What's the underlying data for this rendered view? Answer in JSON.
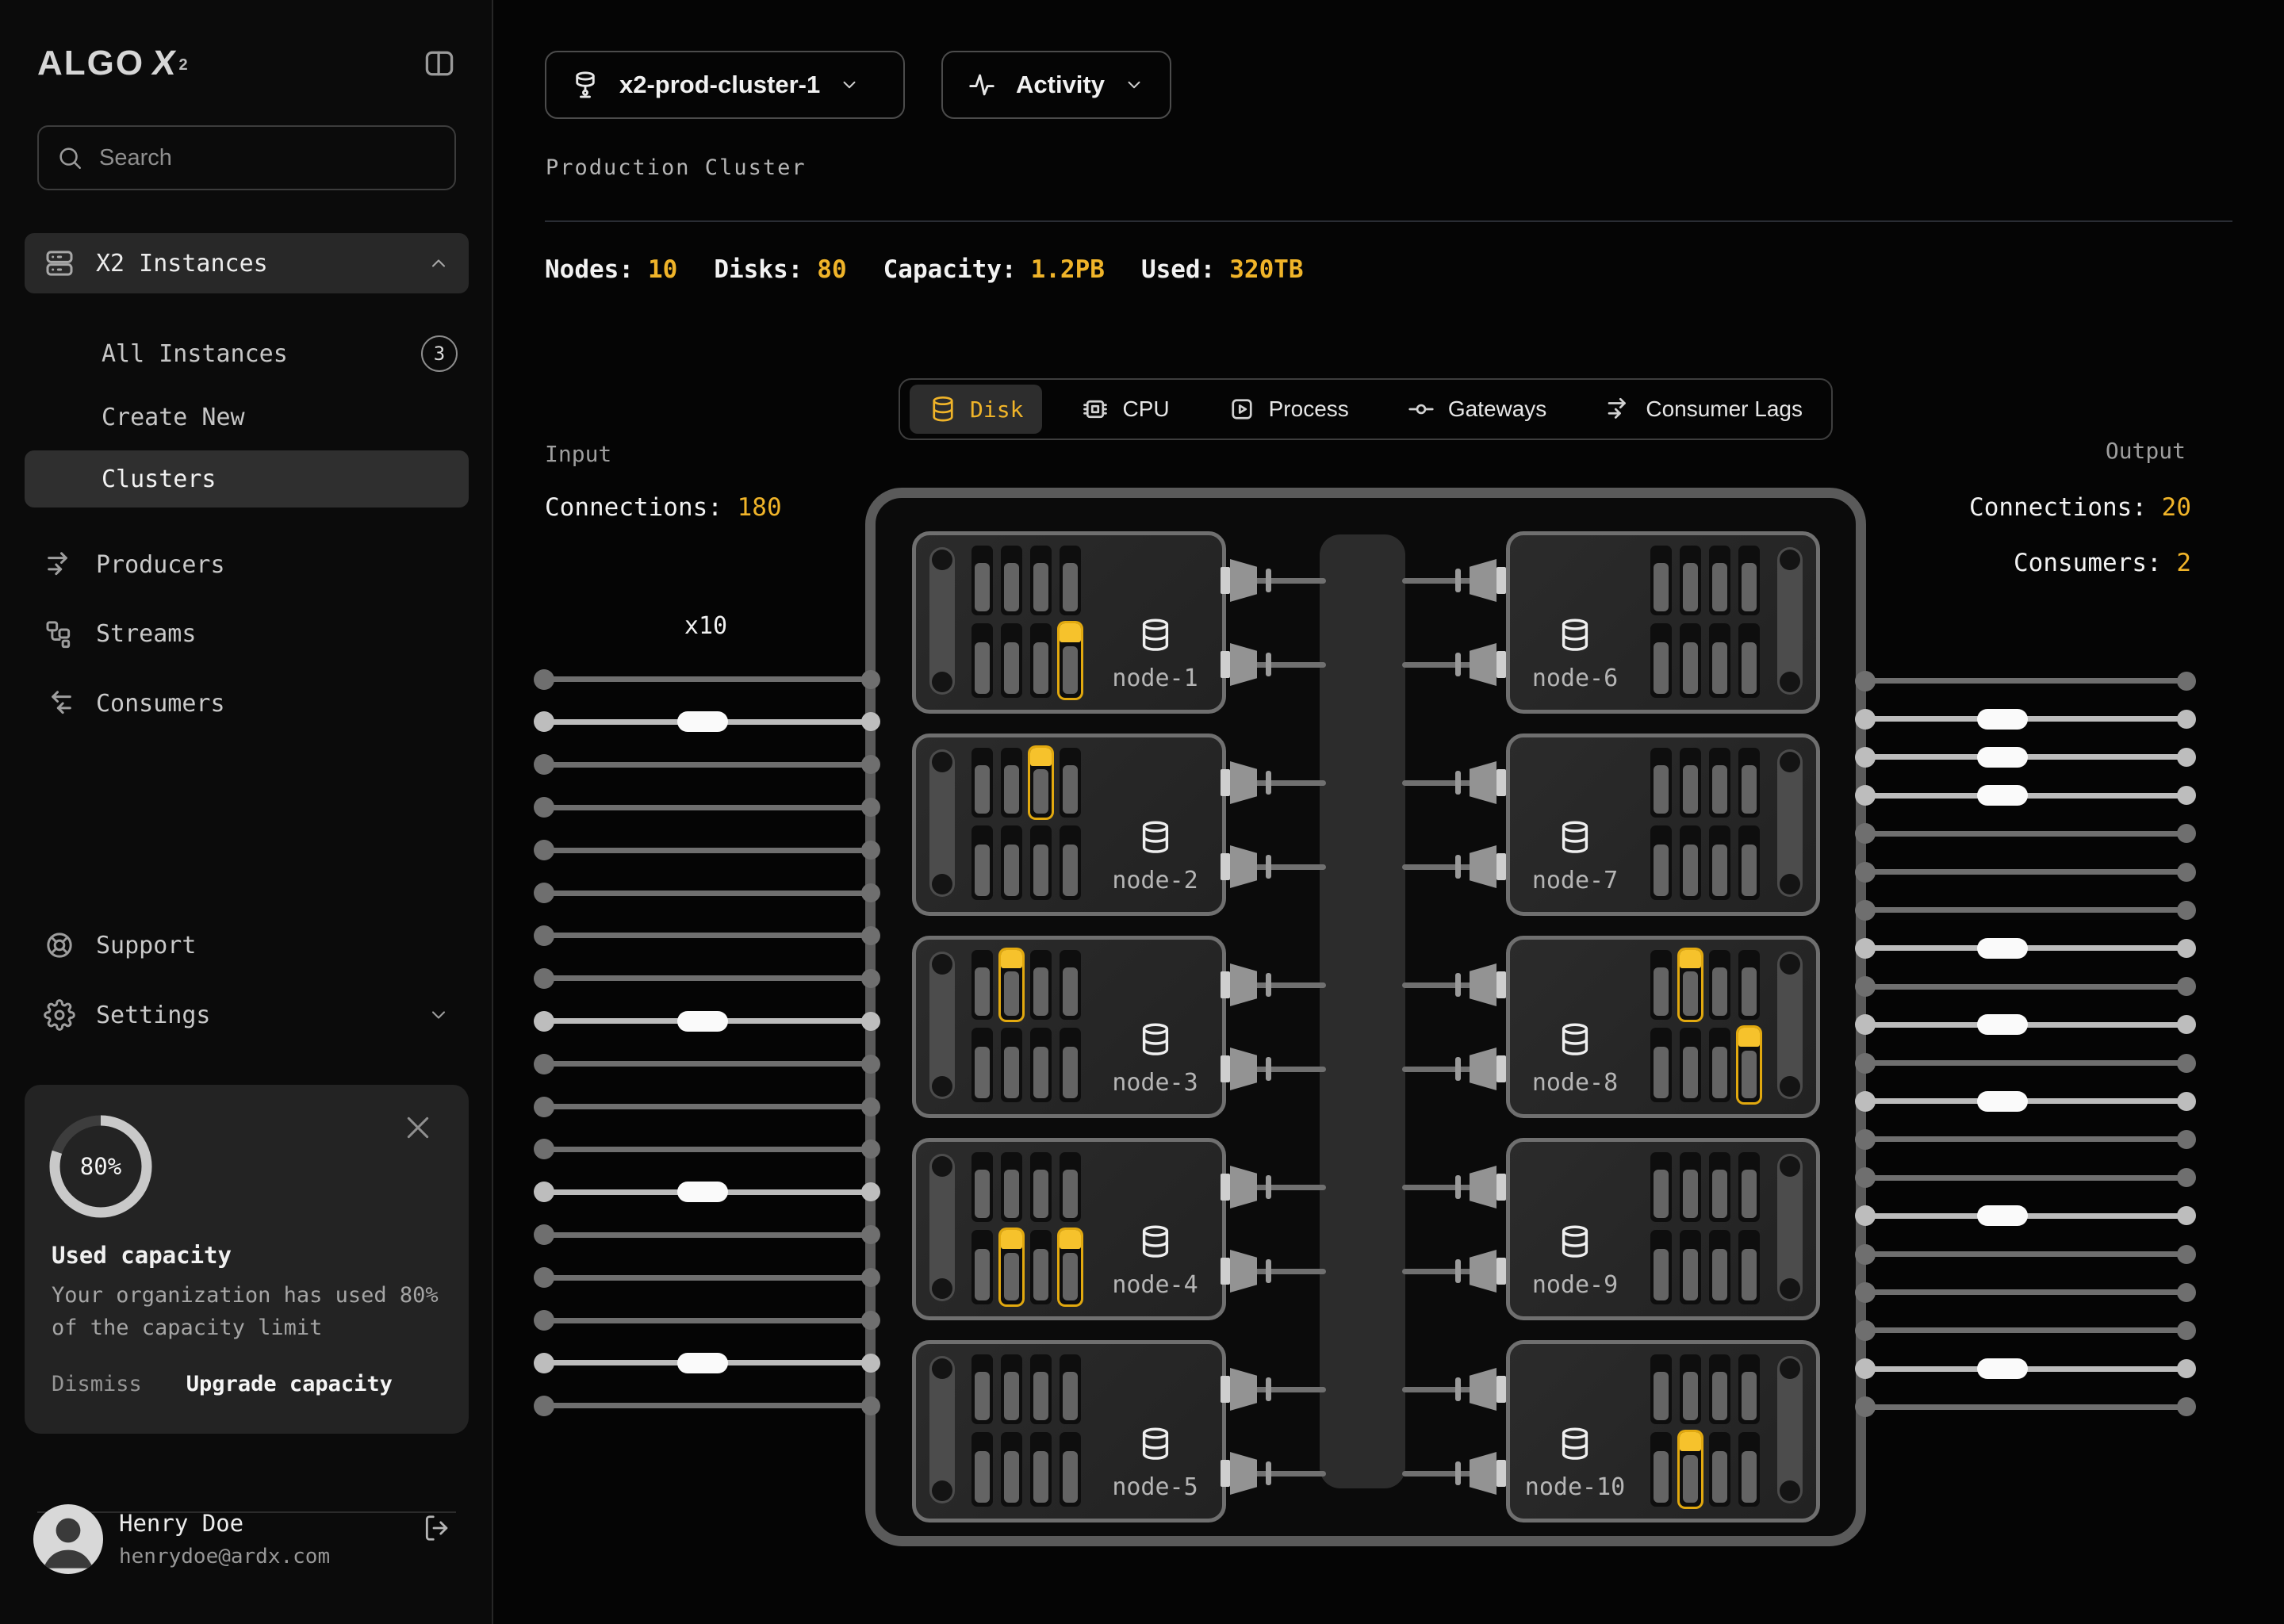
{
  "app": {
    "accent_color": "#F0B429",
    "line_color": "#6f6f6f",
    "line_light_color": "#bdbdbd"
  },
  "sidebar": {
    "logo": {
      "text": "ALGO",
      "x": "X",
      "sup": "2"
    },
    "search": {
      "placeholder": "Search"
    },
    "nav": {
      "group_label": "X2 Instances",
      "items": [
        {
          "label": "All Instances",
          "badge": "3"
        },
        {
          "label": "Create New"
        },
        {
          "label": "Clusters",
          "active": true
        }
      ],
      "links": [
        {
          "label": "Producers",
          "icon": "producers-icon"
        },
        {
          "label": "Streams",
          "icon": "streams-icon"
        },
        {
          "label": "Consumers",
          "icon": "consumers-icon"
        }
      ],
      "footer": [
        {
          "label": "Support",
          "icon": "support-icon"
        },
        {
          "label": "Settings",
          "icon": "settings-icon"
        }
      ]
    },
    "capacity_card": {
      "percent": "80%",
      "percent_value": 80,
      "title": "Used capacity",
      "body": "Your organization has used 80% of the capacity limit",
      "dismiss_label": "Dismiss",
      "upgrade_label": "Upgrade capacity"
    },
    "user": {
      "name": "Henry Doe",
      "email": "henrydoe@ardx.com"
    }
  },
  "header": {
    "cluster_select": "x2-prod-cluster-1",
    "activity_select": "Activity",
    "subtitle": "Production Cluster",
    "stats": [
      {
        "label": "Nodes:",
        "value": "10"
      },
      {
        "label": "Disks:",
        "value": "80"
      },
      {
        "label": "Capacity:",
        "value": "1.2PB"
      },
      {
        "label": "Used:",
        "value": "320TB"
      }
    ]
  },
  "tabs": [
    {
      "label": "Disk",
      "icon": "disk-icon",
      "active": true
    },
    {
      "label": "CPU",
      "icon": "cpu-icon",
      "active": false
    },
    {
      "label": "Process",
      "icon": "process-icon",
      "active": false
    },
    {
      "label": "Gateways",
      "icon": "gateways-icon",
      "active": false
    },
    {
      "label": "Consumer Lags",
      "icon": "consumer-lags-icon",
      "active": false
    }
  ],
  "io": {
    "input": {
      "title": "Input",
      "connections_label": "Connections:",
      "connections": "180",
      "multiplier": "x10"
    },
    "output": {
      "title": "Output",
      "connections_label": "Connections:",
      "connections": "20",
      "consumers_label": "Consumers:",
      "consumers": "2"
    }
  },
  "diagram": {
    "input_lines": {
      "count": 18,
      "handles_at": [
        2,
        9,
        13,
        17
      ]
    },
    "output_lines": {
      "count": 20,
      "handles_at": [
        2,
        3,
        4,
        8,
        10,
        12,
        15,
        19
      ]
    },
    "disks_per_node": {
      "rows": 2,
      "cols": 4
    },
    "nodes": [
      {
        "name": "node-1",
        "side": "left",
        "highlighted_disks": [
          [
            2,
            4
          ]
        ]
      },
      {
        "name": "node-2",
        "side": "left",
        "highlighted_disks": [
          [
            1,
            3
          ]
        ]
      },
      {
        "name": "node-3",
        "side": "left",
        "highlighted_disks": [
          [
            1,
            2
          ]
        ]
      },
      {
        "name": "node-4",
        "side": "left",
        "highlighted_disks": [
          [
            2,
            2
          ],
          [
            2,
            4
          ]
        ]
      },
      {
        "name": "node-5",
        "side": "left",
        "highlighted_disks": []
      },
      {
        "name": "node-6",
        "side": "right",
        "highlighted_disks": []
      },
      {
        "name": "node-7",
        "side": "right",
        "highlighted_disks": []
      },
      {
        "name": "node-8",
        "side": "right",
        "highlighted_disks": [
          [
            1,
            2
          ],
          [
            2,
            4
          ]
        ]
      },
      {
        "name": "node-9",
        "side": "right",
        "highlighted_disks": []
      },
      {
        "name": "node-10",
        "side": "right",
        "highlighted_disks": [
          [
            2,
            2
          ]
        ]
      }
    ]
  }
}
